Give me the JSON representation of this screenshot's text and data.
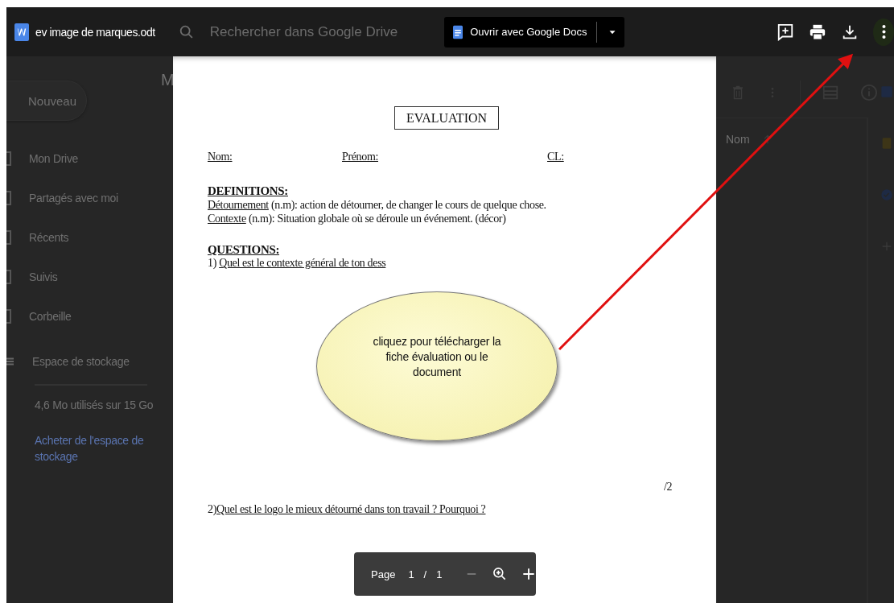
{
  "top_bar": {
    "file_name": "ev image de marques.odt",
    "search_placeholder": "Rechercher dans Google Drive",
    "open_with_button": "Ouvrir avec Google Docs"
  },
  "drive_backdrop": {
    "new_button": "Nouveau",
    "nav_items": [
      {
        "label": "Mon Drive"
      },
      {
        "label": "Partagés avec moi"
      },
      {
        "label": "Récents"
      },
      {
        "label": "Suivis"
      },
      {
        "label": "Corbeille"
      }
    ],
    "storage_label": "Espace de stockage",
    "storage_used": "4,6 Mo utilisés sur 15 Go",
    "buy_storage_link": "Acheter de l'espace de stockage",
    "heading_fragment": "M",
    "sort_column": "Nom"
  },
  "document": {
    "title": "EVALUATION",
    "fields": [
      "Nom:",
      "Prénom:",
      "CL:"
    ],
    "definitions_heading": "DEFINITIONS:",
    "definitions": [
      {
        "term": "Détournement",
        "text": " (n.m): action de détourner, de changer le cours de quelque chose."
      },
      {
        "term": "Contexte",
        "text": " (n.m): Situation globale où se déroule un événement. (décor)"
      }
    ],
    "questions_heading": "QUESTIONS:",
    "questions": [
      {
        "number": "1)",
        "text": "Quel est le contexte général de ton dess"
      },
      {
        "number": "2)",
        "text": "Quel est le logo le mieux détourné dans ton travail ?  Pourquoi ?"
      }
    ],
    "score": "/2"
  },
  "annotation": {
    "text": "cliquez pour télécharger la fiche évaluation ou le document"
  },
  "page_toolbar": {
    "label": "Page",
    "current": "1",
    "separator": "/",
    "total": "1"
  }
}
